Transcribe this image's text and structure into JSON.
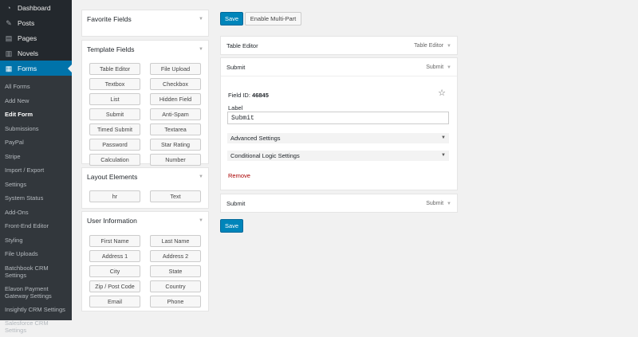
{
  "sidebar": {
    "top_items": [
      {
        "label": "Dashboard",
        "icon": "dashboard-icon"
      },
      {
        "label": "Posts",
        "icon": "pin-icon"
      },
      {
        "label": "Pages",
        "icon": "pages-icon"
      },
      {
        "label": "Novels",
        "icon": "book-icon"
      }
    ],
    "forms_label": "Forms",
    "submenu": [
      "All Forms",
      "Add New",
      "Edit Form",
      "Submissions",
      "PayPal",
      "Stripe",
      "Import / Export",
      "Settings",
      "System Status",
      "Add-Ons",
      "Front-End Editor",
      "Styling",
      "File Uploads",
      "Batchbook CRM Settings",
      "Elavon Payment Gateway Settings",
      "Insightly CRM Settings",
      "Salesforce CRM Settings"
    ],
    "current_submenu": "Edit Form"
  },
  "panels": {
    "favorite": {
      "title": "Favorite Fields"
    },
    "template": {
      "title": "Template Fields",
      "buttons": [
        "Table Editor",
        "File Upload",
        "Textbox",
        "Checkbox",
        "List",
        "Hidden Field",
        "Submit",
        "Anti-Spam",
        "Timed Submit",
        "Textarea",
        "Password",
        "Star Rating",
        "Calculation",
        "Number"
      ]
    },
    "layout": {
      "title": "Layout Elements",
      "buttons": [
        "hr",
        "Text"
      ]
    },
    "user": {
      "title": "User Information",
      "buttons": [
        "First Name",
        "Last Name",
        "Address 1",
        "Address 2",
        "City",
        "State",
        "Zip / Post Code",
        "Country",
        "Email",
        "Phone"
      ]
    }
  },
  "toolbar": {
    "save_label": "Save",
    "multipart_label": "Enable Multi-Part"
  },
  "fields": {
    "table_editor": {
      "title": "Table Editor",
      "type": "Table Editor"
    },
    "submit_open": {
      "title": "Submit",
      "type": "Submit",
      "field_id_label": "Field ID:",
      "field_id": "46845",
      "label_caption": "Label",
      "label_value": "Submit",
      "advanced": "Advanced Settings",
      "conditional": "Conditional Logic Settings",
      "remove": "Remove"
    },
    "submit_closed": {
      "title": "Submit",
      "type": "Submit"
    }
  },
  "bottom_save_label": "Save"
}
